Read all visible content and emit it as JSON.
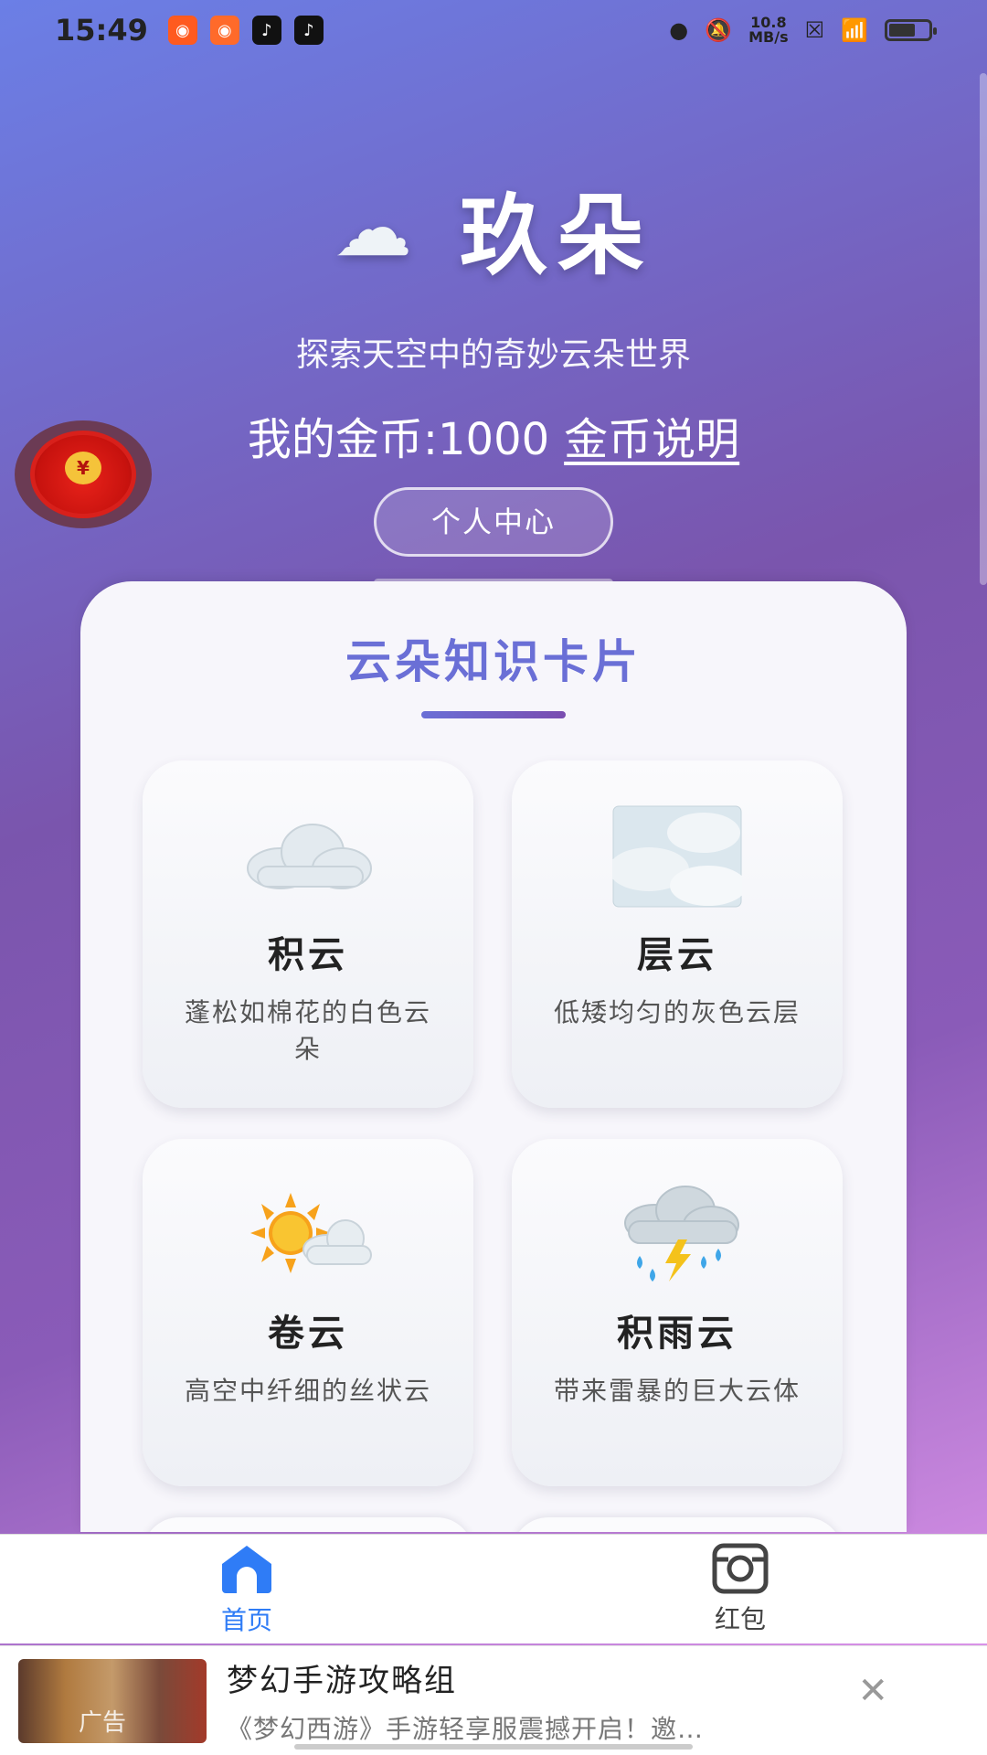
{
  "status_bar": {
    "time": "15:49",
    "net_speed_value": "10.8",
    "net_speed_unit": "MB/s",
    "battery_level": 0.6
  },
  "hero": {
    "app_name": "玖朵",
    "subtitle": "探索天空中的奇妙云朵世界",
    "coins_label": "我的金币:1000",
    "coins_link": "金币说明",
    "profile_button": "个人中心"
  },
  "panel": {
    "title": "云朵知识卡片",
    "cards": [
      {
        "name": "积云",
        "desc": "蓬松如棉花的白色云朵",
        "icon": "cloud-icon"
      },
      {
        "name": "层云",
        "desc": "低矮均匀的灰色云层",
        "icon": "fog-icon"
      },
      {
        "name": "卷云",
        "desc": "高空中纤细的丝状云",
        "icon": "sun-behind-cloud-icon"
      },
      {
        "name": "积雨云",
        "desc": "带来雷暴的巨大云体",
        "icon": "thunder-rain-cloud-icon"
      }
    ]
  },
  "bottom_nav": {
    "home_label": "首页",
    "redpacket_label": "红包"
  },
  "ad": {
    "tag": "广告",
    "title": "梦幻手游攻略组",
    "desc": "《梦幻西游》手游轻享服震撼开启！邀…"
  },
  "redpacket_badge": "¥",
  "colors": {
    "accent": "#6a6fd6",
    "nav_active": "#2f7cf6",
    "gradient_start": "#6b7fe6",
    "gradient_end": "#e79cf0"
  }
}
